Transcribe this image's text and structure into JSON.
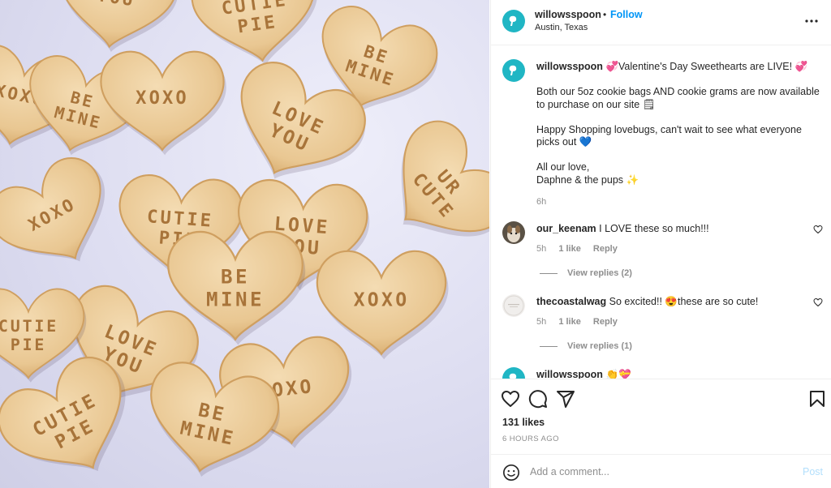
{
  "post": {
    "username": "willowsspoon",
    "follow_label": "Follow",
    "separator": "•",
    "location": "Austin, Texas",
    "more_icon": "more-horizontal-icon",
    "brand_color": "#20b6c4",
    "image": {
      "alt": "Heart-shaped sugar cookies stamped with conversation-heart sayings",
      "cookie_texts": [
        "YOU",
        "CUTIE PIE",
        "XOXO",
        "BE MINE",
        "XOXO",
        "BE MINE",
        "LOVE YOU",
        "UR CUTE",
        "XOXO",
        "CUTIE PIE",
        "LOVE YOU",
        "BE MINE",
        "XOXO",
        "LOVE YOU",
        "CUTIE PIE",
        "XOXO",
        "CUTIE PIE",
        "BE MINE"
      ]
    }
  },
  "caption": {
    "username": "willowsspoon",
    "line1": "💞Valentine's Day Sweethearts are LIVE! 💞",
    "line2": "Both our 5oz cookie bags AND cookie grams are now available to purchase on our site 🗒",
    "line3": "Happy Shopping lovebugs, can't wait to see what everyone picks out 💙",
    "line4": "All our love,",
    "line5": "Daphne & the pups ✨",
    "time": "6h"
  },
  "comments": [
    {
      "username": "our_keenam",
      "text": "I LOVE these so much!!!",
      "time": "5h",
      "likes": "1 like",
      "reply_label": "Reply",
      "view_replies": "View replies (2)"
    },
    {
      "username": "thecoastalwag",
      "text": "So excited!! 😍these are so cute!",
      "time": "5h",
      "likes": "1 like",
      "reply_label": "Reply",
      "view_replies": "View replies (1)"
    },
    {
      "username": "willowsspoon",
      "text": "👏💝"
    }
  ],
  "actions": {
    "icons": [
      "heart-icon",
      "comment-icon",
      "share-icon",
      "bookmark-icon"
    ],
    "likes": "131 likes",
    "time_ago": "6 HOURS AGO"
  },
  "add_comment": {
    "placeholder": "Add a comment...",
    "post_label": "Post",
    "emoji_icon": "emoji-icon"
  }
}
